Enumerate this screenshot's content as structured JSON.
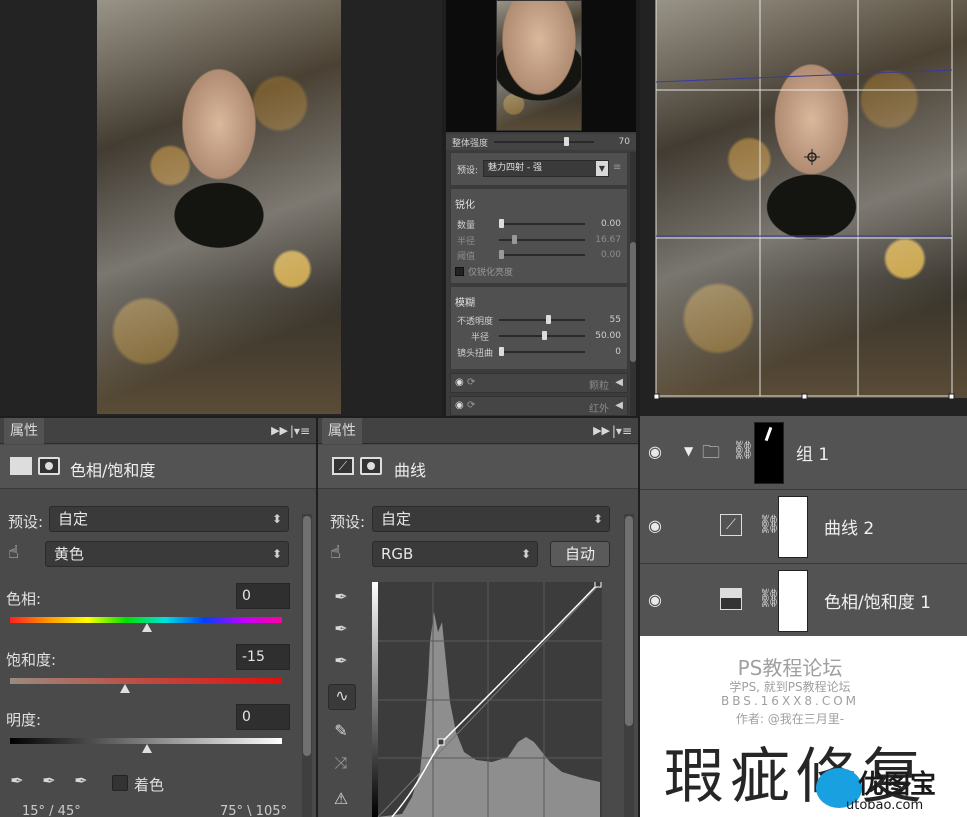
{
  "top_panel": {
    "overall_strength_label": "整体强度",
    "overall_strength_value": "70",
    "overall_strength_level": 0.7,
    "preset_label": "预设:",
    "preset_value": "魅力四射 - 强",
    "sharpen_title": "锐化",
    "sharpen_rows": [
      {
        "label": "数量",
        "value": "0.00",
        "level": 0.0,
        "dim": false
      },
      {
        "label": "半径",
        "value": "16.67",
        "level": 0.15,
        "dim": true
      },
      {
        "label": "阈值",
        "value": "0.00",
        "level": 0.0,
        "dim": true
      }
    ],
    "sharpen_checkbox": "仅锐化亮度",
    "vignette_title": "模糊",
    "vignette_rows": [
      {
        "label": "不透明度",
        "value": "55",
        "level": 0.55
      },
      {
        "label": "半径",
        "value": "50.00",
        "level": 0.5
      },
      {
        "label": "镜头扭曲",
        "value": "0",
        "level": 0.0
      }
    ],
    "tab_grain": "颗粒",
    "tab_infrared": "红外"
  },
  "hue_panel": {
    "header": "属性",
    "title": "色相/饱和度",
    "preset_label": "预设:",
    "preset_value": "自定",
    "channel_value": "黄色",
    "hue_label": "色相:",
    "hue_value": "0",
    "hue_level": 0.5,
    "sat_label": "饱和度:",
    "sat_value": "-15",
    "sat_level": 0.42,
    "light_label": "明度:",
    "light_value": "0",
    "light_level": 0.5,
    "colorize_label": "着色",
    "range_left": "15° / 45°",
    "range_right": "75° \\ 105°"
  },
  "curves_panel": {
    "header": "属性",
    "title": "曲线",
    "preset_label": "预设:",
    "preset_value": "自定",
    "channel_value": "RGB",
    "auto_button": "自动"
  },
  "layers": [
    {
      "name": "组 1",
      "type": "group"
    },
    {
      "name": "曲线 2",
      "type": "curves"
    },
    {
      "name": "色相/饱和度 1",
      "type": "hue"
    }
  ],
  "watermark": {
    "line1": "PS教程论坛",
    "line2": "学PS, 就到PS教程论坛",
    "line3": "BBS.16XX8.COM",
    "line4": "作者: @我在三月里-",
    "big_title": "瑕疵修复",
    "logo_text": "优图宝",
    "logo_url": "utobao.com"
  }
}
